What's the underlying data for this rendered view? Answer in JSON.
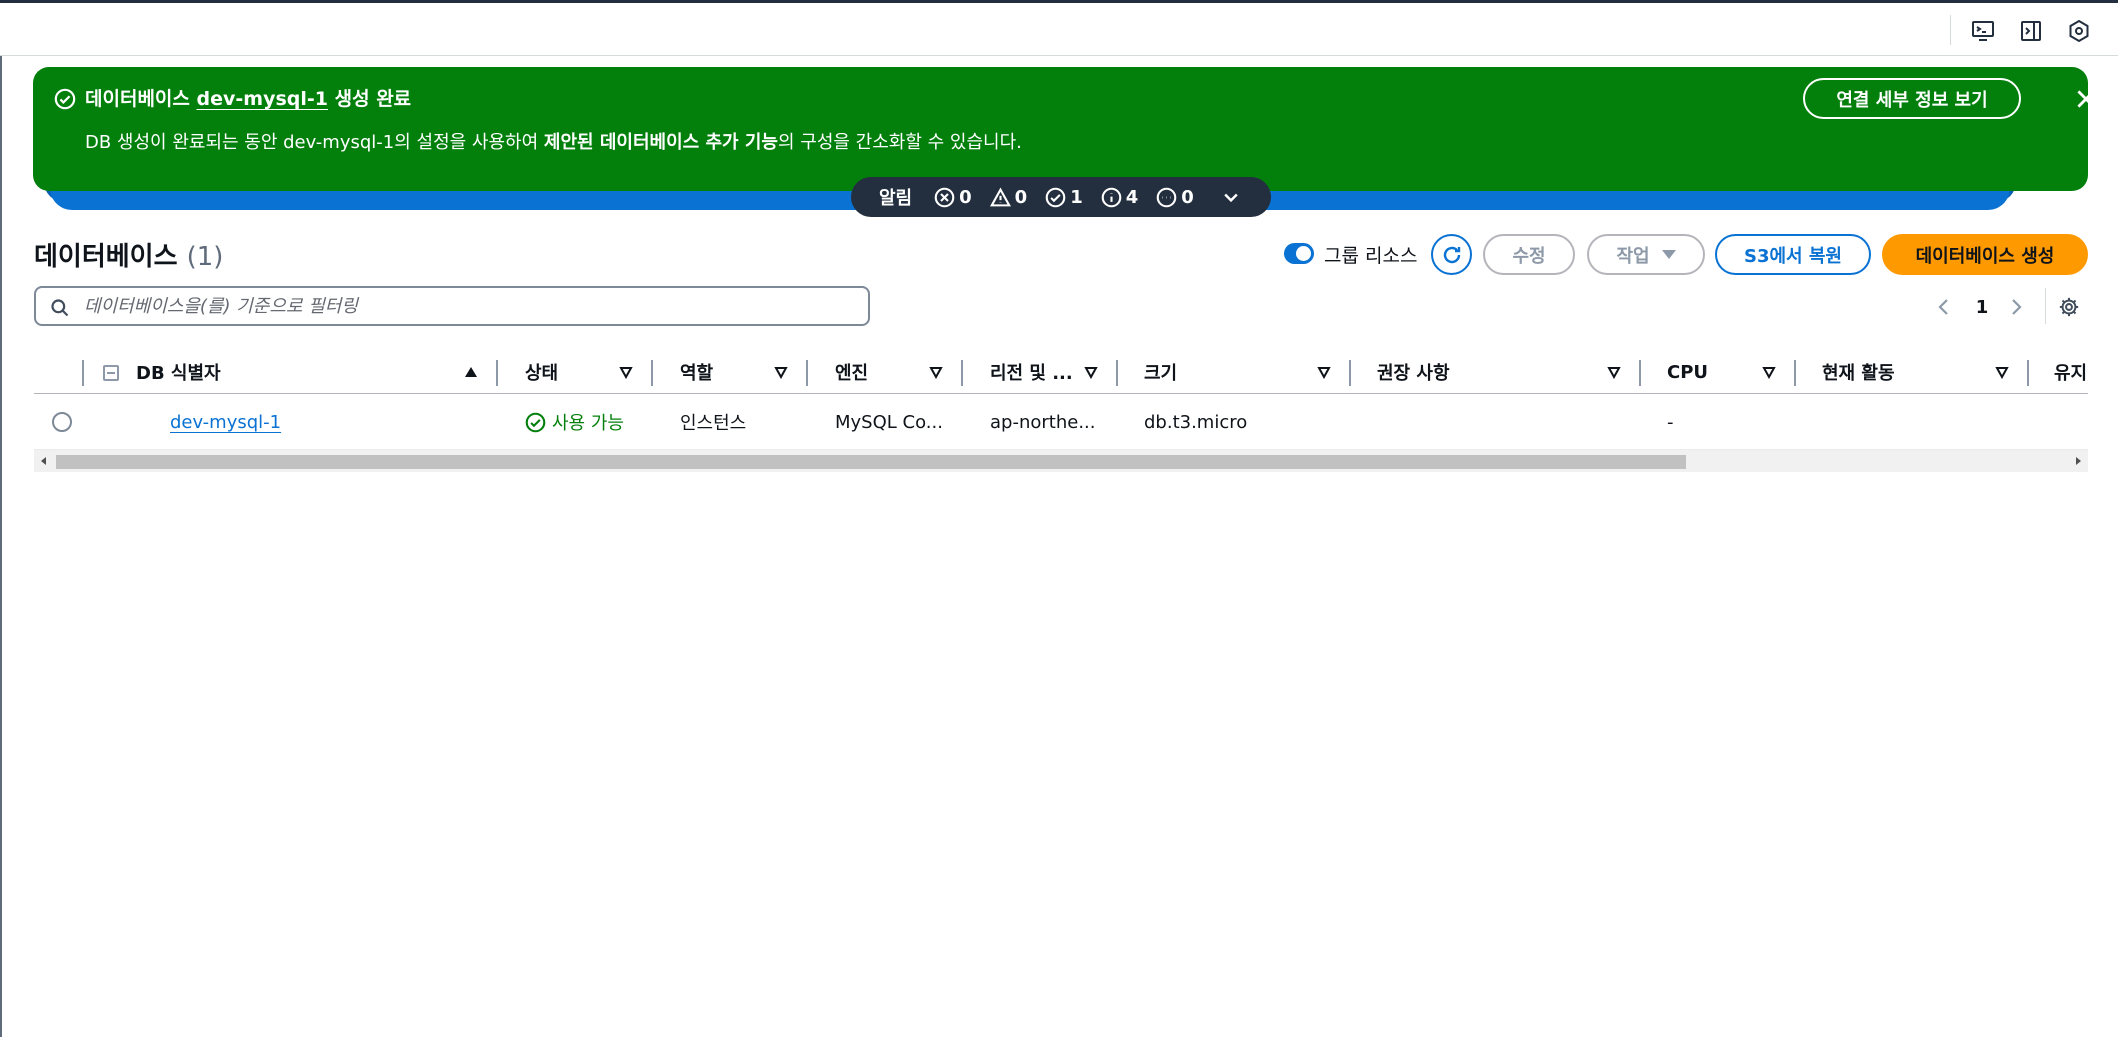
{
  "toolbar": {
    "icons": [
      "cloudshell-icon",
      "panel-expand-icon",
      "settings-hex-icon"
    ]
  },
  "flash": {
    "title_prefix": "데이터베이스",
    "resource": "dev-mysql-1",
    "title_suffix": "생성 완료",
    "desc_part1": "DB 생성이 완료되는 동안 dev-mysql-1의 설정을 사용하여 ",
    "desc_bold": "제안된 데이터베이스 추가 기능",
    "desc_part2": "의 구성을 간소화할 수 있습니다.",
    "button_label": "연결 세부 정보 보기",
    "background": "#037f0c"
  },
  "notifications": {
    "label": "알림",
    "error_count": "0",
    "warning_count": "0",
    "success_count": "1",
    "info_count": "4",
    "in_progress_count": "0"
  },
  "header": {
    "title": "데이터베이스",
    "count": "(1)",
    "group_toggle_label": "그룹 리소스",
    "group_toggle_on": true,
    "modify_label": "수정",
    "actions_label": "작업",
    "restore_label": "S3에서 복원",
    "create_label": "데이터베이스 생성"
  },
  "search": {
    "placeholder": "데이터베이스을(를) 기준으로 필터링",
    "value": ""
  },
  "pagination": {
    "current_page": "1"
  },
  "table": {
    "columns": [
      "DB 식별자",
      "상태",
      "역할",
      "엔진",
      "리전 및 ...",
      "크기",
      "권장 사항",
      "CPU",
      "현재 활동",
      "유지"
    ],
    "rows": [
      {
        "identifier": "dev-mysql-1",
        "status": "사용 가능",
        "role": "인스턴스",
        "engine": "MySQL Co...",
        "region": "ap-northe...",
        "size": "db.t3.micro",
        "recommendations": "",
        "cpu": "-",
        "activity": "",
        "maintenance": ""
      }
    ]
  },
  "colors": {
    "accent": "#0972d3",
    "success": "#037f0c",
    "primary_button": "#ff9900",
    "notification_bar": "#232f3e"
  }
}
